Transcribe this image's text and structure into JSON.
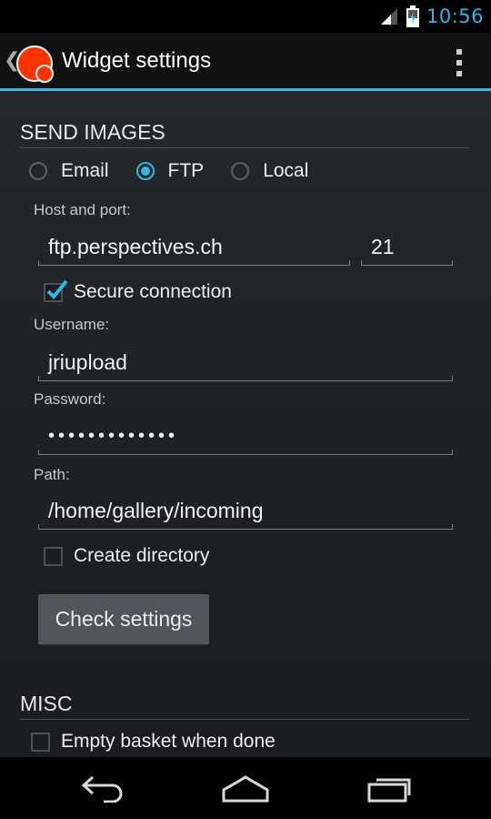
{
  "status_bar": {
    "time": "10:56"
  },
  "action_bar": {
    "title": "Widget settings"
  },
  "send_images": {
    "header": "SEND IMAGES",
    "methods": [
      {
        "label": "Email",
        "selected": false
      },
      {
        "label": "FTP",
        "selected": true
      },
      {
        "label": "Local",
        "selected": false
      }
    ],
    "host_label": "Host and port:",
    "host_value": "ftp.perspectives.ch",
    "port_value": "21",
    "secure_label": "Secure connection",
    "secure_checked": true,
    "username_label": "Username:",
    "username_value": "jriupload",
    "password_label": "Password:",
    "password_value": "•••••••••••••",
    "path_label": "Path:",
    "path_value": "/home/gallery/incoming",
    "create_dir_label": "Create directory",
    "create_dir_checked": false,
    "check_button": "Check settings"
  },
  "misc": {
    "header": "MISC",
    "empty_basket_label": "Empty basket when done",
    "empty_basket_checked": false
  },
  "colors": {
    "accent": "#33b5e5",
    "app_icon": "#ff3300"
  }
}
